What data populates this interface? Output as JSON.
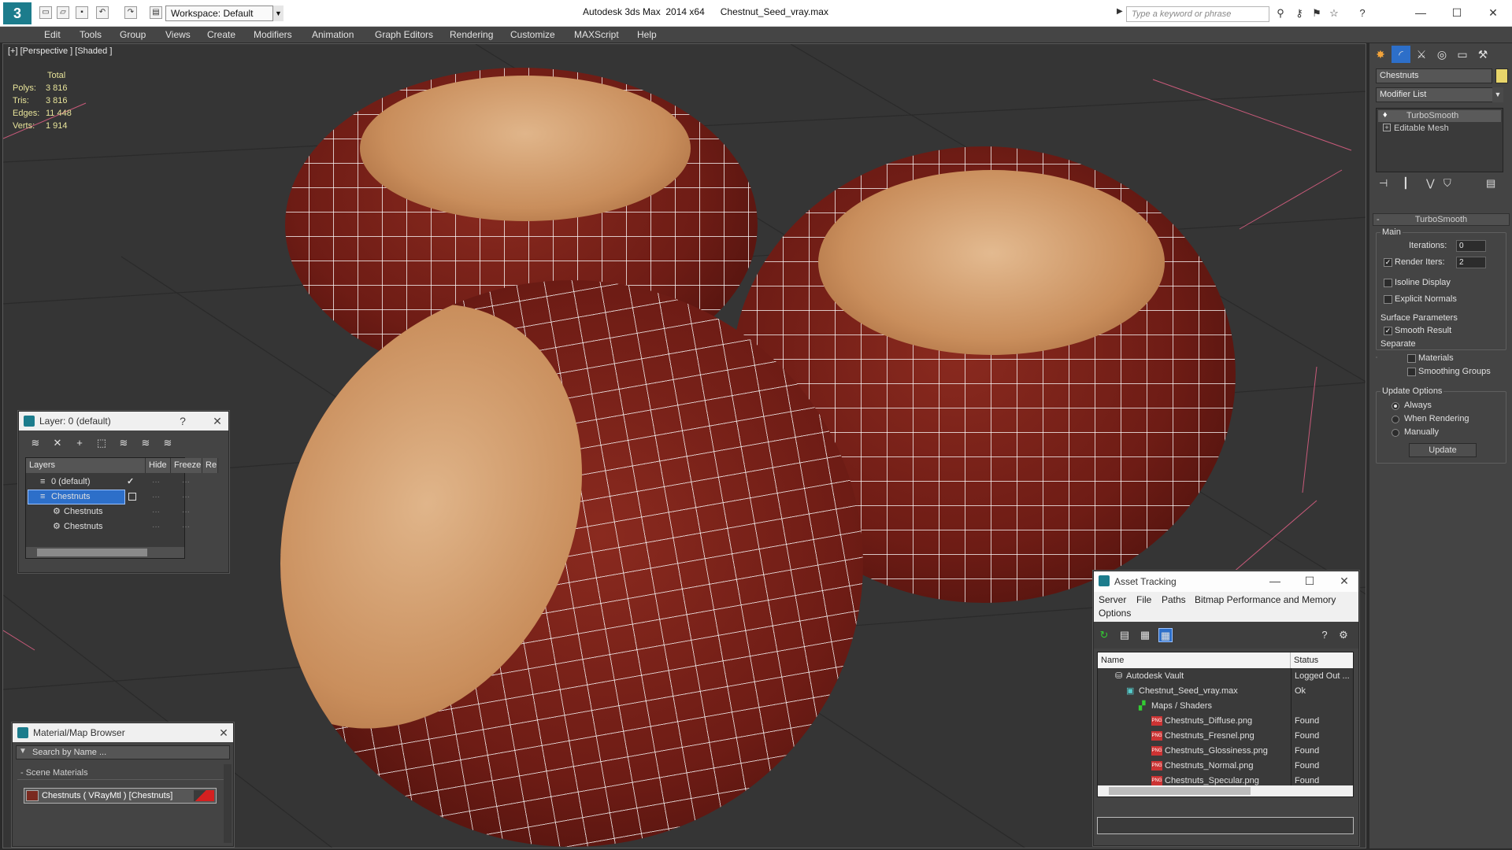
{
  "titlebar": {
    "logo": "3",
    "workspace": "Workspace: Default",
    "app_title": "Autodesk 3ds Max  2014 x64      Chestnut_Seed_vray.max",
    "search_placeholder": "Type a keyword or phrase",
    "window_controls": [
      "—",
      "☐",
      "✕"
    ]
  },
  "menu": [
    "Edit",
    "Tools",
    "Group",
    "Views",
    "Create",
    "Modifiers",
    "Animation",
    "Graph Editors",
    "Rendering",
    "Customize",
    "MAXScript",
    "Help"
  ],
  "viewport": {
    "label": "[+] [Perspective ] [Shaded ]",
    "stats": {
      "header": "Total",
      "rows": [
        {
          "label": "Polys:",
          "value": "3 816"
        },
        {
          "label": "Tris:",
          "value": "3 816"
        },
        {
          "label": "Edges:",
          "value": "11 448"
        },
        {
          "label": "Verts:",
          "value": "1 914"
        }
      ]
    }
  },
  "layer_window": {
    "title": "Layer: 0 (default)",
    "help": "?",
    "close": "✕",
    "columns": [
      "Layers",
      "Hide",
      "Freeze",
      "Re"
    ],
    "rows": [
      {
        "name": "0 (default)",
        "check": "✓"
      },
      {
        "name": "Chestnuts"
      },
      {
        "name": "Chestnuts"
      },
      {
        "name": "Chestnuts"
      }
    ]
  },
  "material_window": {
    "title": "Material/Map Browser",
    "close": "✕",
    "search_placeholder": "Search by Name ...",
    "section": "- Scene Materials",
    "item": "Chestnuts  ( VRayMtl )  [Chestnuts]"
  },
  "asset_window": {
    "title": "Asset Tracking",
    "menu": [
      "Server",
      "File",
      "Paths",
      "Bitmap Performance and Memory",
      "Options"
    ],
    "columns": [
      "Name",
      "Status"
    ],
    "rows": [
      {
        "name": "Autodesk Vault",
        "status": "Logged Out ..."
      },
      {
        "name": "Chestnut_Seed_vray.max",
        "status": "Ok"
      },
      {
        "name": "Maps / Shaders",
        "status": ""
      },
      {
        "name": "Chestnuts_Diffuse.png",
        "status": "Found"
      },
      {
        "name": "Chestnuts_Fresnel.png",
        "status": "Found"
      },
      {
        "name": "Chestnuts_Glossiness.png",
        "status": "Found"
      },
      {
        "name": "Chestnuts_Normal.png",
        "status": "Found"
      },
      {
        "name": "Chestnuts_Specular.png",
        "status": "Found"
      }
    ],
    "png_label": "PNG",
    "window_controls": [
      "—",
      "☐",
      "✕"
    ]
  },
  "command_panel": {
    "object_name": "Chestnuts",
    "modifier_list": "Modifier List",
    "stack": [
      "TurboSmooth",
      "Editable Mesh"
    ],
    "rollout_title": "TurboSmooth",
    "main_label": "Main",
    "iterations_label": "Iterations:",
    "iterations_value": "0",
    "render_iters_label": "Render Iters:",
    "render_iters_value": "2",
    "isoline": "Isoline Display",
    "explicit_normals": "Explicit Normals",
    "surface_params": "Surface Parameters",
    "smooth_result": "Smooth Result",
    "separate": "Separate",
    "materials": "Materials",
    "smoothing_groups": "Smoothing Groups",
    "update_options": "Update Options",
    "always": "Always",
    "when_rendering": "When Rendering",
    "manually": "Manually",
    "update_button": "Update",
    "collapse": "-"
  },
  "colors": {
    "shell": "#6e1c15",
    "cap": "#c98e5c",
    "mesh": "#ffffff",
    "accent": "#1c7c8c"
  }
}
